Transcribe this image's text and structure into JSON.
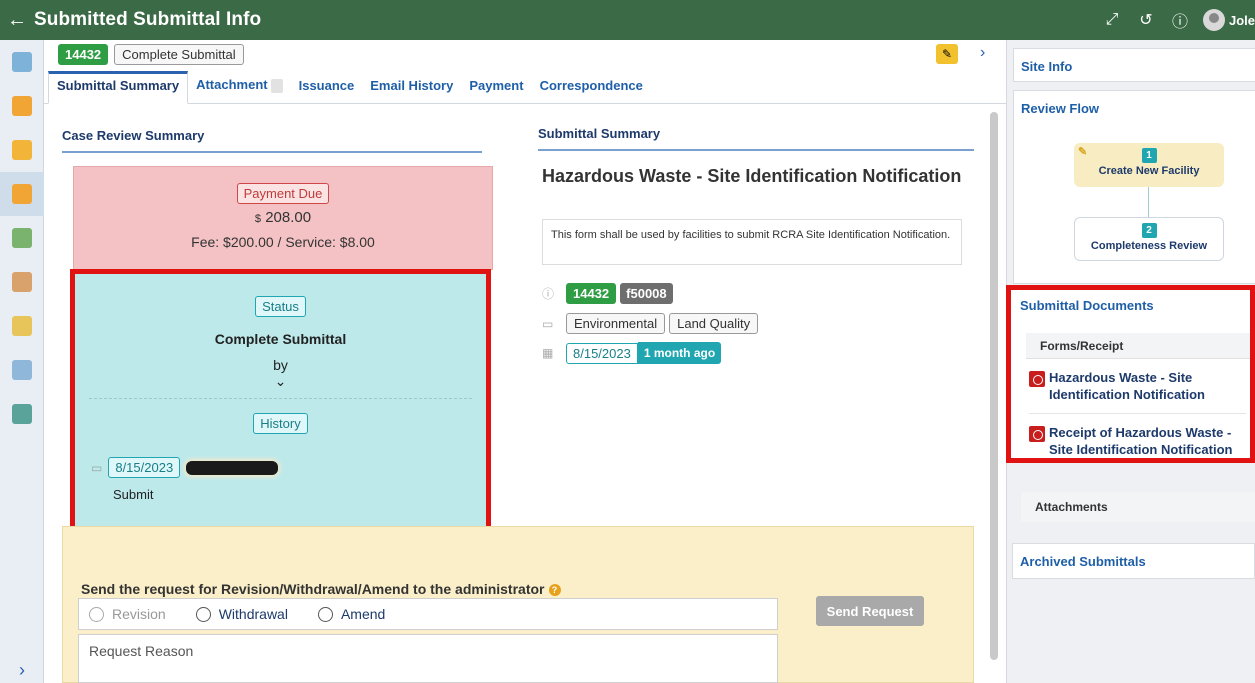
{
  "topbar": {
    "back": "←",
    "title": "Submitted Submittal Info",
    "user_name": "Jole",
    "icons": [
      "expand-arrows-icon",
      "history-icon",
      "help-icon",
      "user-avatar"
    ]
  },
  "leftnav": {
    "items": [
      "dashboard-icon",
      "new-form-icon",
      "drafts-icon",
      "submittals-icon",
      "reports-icon",
      "handshake-icon",
      "documents-icon",
      "search-icon",
      "facility-icon"
    ],
    "expand": "›"
  },
  "header": {
    "id": "14432",
    "status": "Complete Submittal"
  },
  "tabs": [
    {
      "label": "Submittal Summary",
      "active": true
    },
    {
      "label": "Attachment"
    },
    {
      "label": "Issuance"
    },
    {
      "label": "Email History"
    },
    {
      "label": "Payment"
    },
    {
      "label": "Correspondence"
    }
  ],
  "case_review": {
    "title": "Case Review Summary",
    "payment_badge": "Payment Due",
    "amount_symbol": "$",
    "amount": "208.00",
    "fee_text": "Fee: $200.00 / Service: $8.00",
    "status_badge": "Status",
    "status": "Complete Submittal",
    "by": "by",
    "history_badge": "History",
    "history_date": "8/15/2023",
    "history_action": "Submit"
  },
  "submittal_summary": {
    "title": "Submittal Summary",
    "form_title": "Hazardous Waste - Site Identification Notification",
    "description": "This form shall be used by facilities to submit RCRA Site Identification Notification.",
    "id": "14432",
    "code": "f50008",
    "category": "Environmental",
    "division": "Land Quality",
    "date": "8/15/2023",
    "ago": "1 month ago"
  },
  "request": {
    "heading": "Send the request for Revision/Withdrawal/Amend to the administrator",
    "help": "?",
    "options": [
      "Revision",
      "Withdrawal",
      "Amend"
    ],
    "send_label": "Send Request",
    "reason_placeholder": "Request Reason"
  },
  "rightpane": {
    "site_info": "Site Info",
    "review_flow": "Review Flow",
    "flow": [
      {
        "num": "1",
        "label": "Create New Facility"
      },
      {
        "num": "2",
        "label": "Completeness Review"
      }
    ],
    "docs_title": "Submittal Documents",
    "forms_receipt": "Forms/Receipt",
    "documents": [
      "Hazardous Waste - Site Identification Notification",
      "Receipt of Hazardous Waste - Site Identification Notification"
    ],
    "attachments": "Attachments",
    "archived": "Archived Submittals"
  },
  "colors": {
    "topbar": "#3b6a46",
    "accent": "#1f5fa8",
    "highlight": "#e01212",
    "teal": "#1fa6b0",
    "green": "#2e9d43"
  }
}
